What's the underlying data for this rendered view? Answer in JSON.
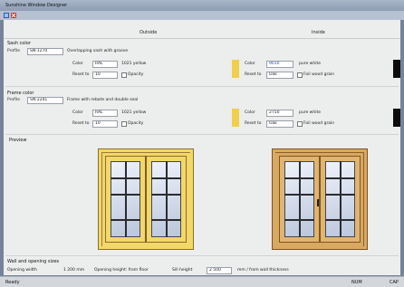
{
  "window": {
    "title": "Sunshine Window Designer"
  },
  "menubar": {
    "icons": [
      "app-icon",
      "close-icon"
    ]
  },
  "columns": {
    "left": "Outside",
    "right": "Inside"
  },
  "sash": {
    "title": "Sash color",
    "profile_label": "Profile",
    "profile_value": "SN-1270",
    "profile_desc": "Overlapping sash with groove",
    "left": {
      "color_label": "Color",
      "color_value": "RAL",
      "color_name": "1021 yellow",
      "reset_label": "Reset to",
      "reset_value": "10",
      "opacity_label": "Opacity"
    },
    "right": {
      "color_label": "Color",
      "color_value": "9010",
      "color_name": "pure white",
      "reset_label": "Reset to",
      "reset_value": "Oak",
      "opacity_label": "Foil wood grain"
    }
  },
  "frame": {
    "title": "Frame color",
    "profile_label": "Profile",
    "profile_value": "SN-2241",
    "profile_desc": "Frame with rebate and double seal",
    "left": {
      "color_label": "Color",
      "color_value": "RAL",
      "color_name": "1021 yellow",
      "reset_label": "Reset to",
      "reset_value": "10",
      "opacity_label": "Opacity"
    },
    "right": {
      "color_label": "Color",
      "color_value": "2750",
      "color_name": "pure white",
      "reset_label": "Reset to",
      "reset_value": "Oak",
      "opacity_label": "Foil wood grain"
    }
  },
  "colors": {
    "yellow": "#f0cf4a",
    "black": "#0c0c0c",
    "frame_yellow": "#f2d76a",
    "wood": "#d9a961"
  },
  "previews": {
    "title": "Preview"
  },
  "wall": {
    "title": "Wall and opening sizes",
    "width_label": "Opening width",
    "width_value": "1 200 mm",
    "height_label": "Opening height: from floor",
    "sill_label": "Sill height",
    "sill_value": "2 500",
    "sill_unit": "mm / from wall thickness"
  },
  "status": {
    "left": "Ready",
    "mid": "NUM",
    "right": "CAP"
  }
}
